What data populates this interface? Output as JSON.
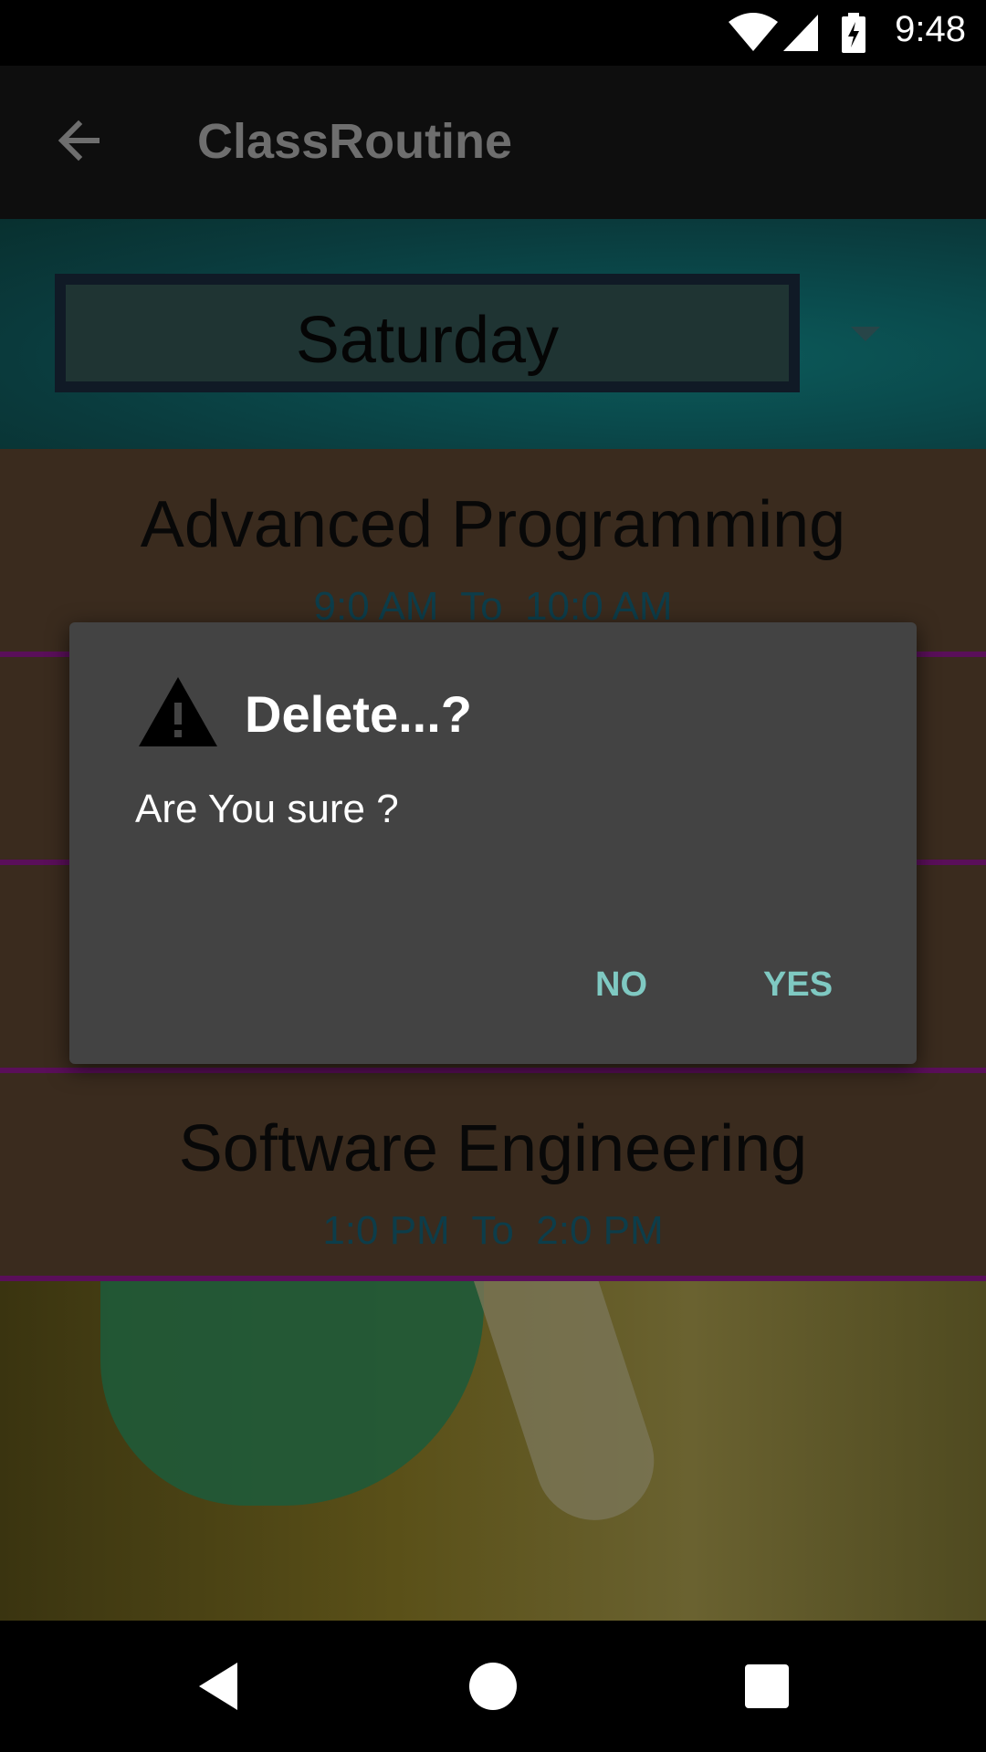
{
  "status_bar": {
    "time": "9:48"
  },
  "app_bar": {
    "title": "ClassRoutine"
  },
  "day_spinner": {
    "selected": "Saturday"
  },
  "classes": [
    {
      "subject": "Advanced Programming",
      "timing": "9:0 AM  To  10:0 AM"
    },
    {
      "subject": "",
      "timing": ""
    },
    {
      "subject": "",
      "timing": ""
    },
    {
      "subject": "Software Engineering",
      "timing": "1:0 PM  To  2:0 PM"
    }
  ],
  "dialog": {
    "title": "Delete...?",
    "message": "Are You sure ?",
    "no_label": "NO",
    "yes_label": "YES"
  },
  "colors": {
    "dialog_bg": "#434343",
    "button_accent": "#7fc9c2",
    "row_divider": "#5a0f5a"
  }
}
